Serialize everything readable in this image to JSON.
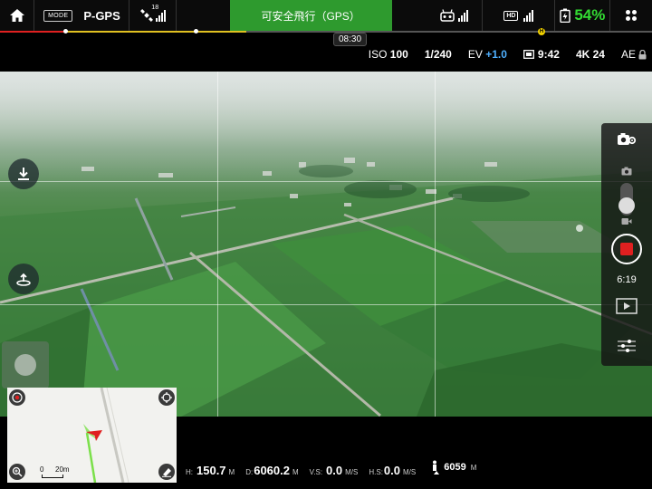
{
  "topbar": {
    "mode_badge": "MODE",
    "flight_mode": "P-GPS",
    "satellite_count": "18",
    "status_text": "可安全飛行（GPS）",
    "hd_badge": "HD",
    "battery_percent": "54%"
  },
  "flight_time": "08:30",
  "home_badge": "H",
  "camera_params": {
    "iso_label": "ISO",
    "iso_value": "100",
    "shutter": "1/240",
    "ev_label": "EV",
    "ev_value": "+1.0",
    "remaining_time": "9:42",
    "resolution": "4K 24",
    "ae_label": "AE"
  },
  "record": {
    "elapsed": "6:19"
  },
  "map": {
    "scale_zero": "0",
    "scale_distance": "20m"
  },
  "telemetry": {
    "height_label": "H:",
    "height_value": "150.7",
    "height_unit": "M",
    "distance_label": "D:",
    "distance_value": "6060.2",
    "distance_unit": "M",
    "vspeed_label": "V.S:",
    "vspeed_value": "0.0",
    "vspeed_unit": "M/S",
    "hspeed_label": "H.S:",
    "hspeed_value": "0.0",
    "hspeed_unit": "M/S",
    "home_distance_value": "6059",
    "home_distance_unit": "M"
  },
  "colors": {
    "status_banner": "#2e9a2e",
    "battery": "#33dd33",
    "ev": "#4fb0ff",
    "record": "#e02020",
    "progress_red": "#e02020",
    "progress_yellow": "#e0c020"
  },
  "icons": [
    "home-icon",
    "satellite-icon",
    "signal-bars-icon",
    "remote-controller-icon",
    "hd-video-link-icon",
    "battery-icon",
    "menu-dots-icon",
    "photo-frame-icon",
    "download-icon",
    "takeoff-landing-icon",
    "camera-settings-icon",
    "photo-mode-icon",
    "video-mode-icon",
    "record-icon",
    "playback-icon",
    "sliders-icon",
    "compass-icon",
    "locate-icon",
    "zoom-icon",
    "eraser-icon",
    "aircraft-arrow-icon",
    "home-distance-icon"
  ]
}
